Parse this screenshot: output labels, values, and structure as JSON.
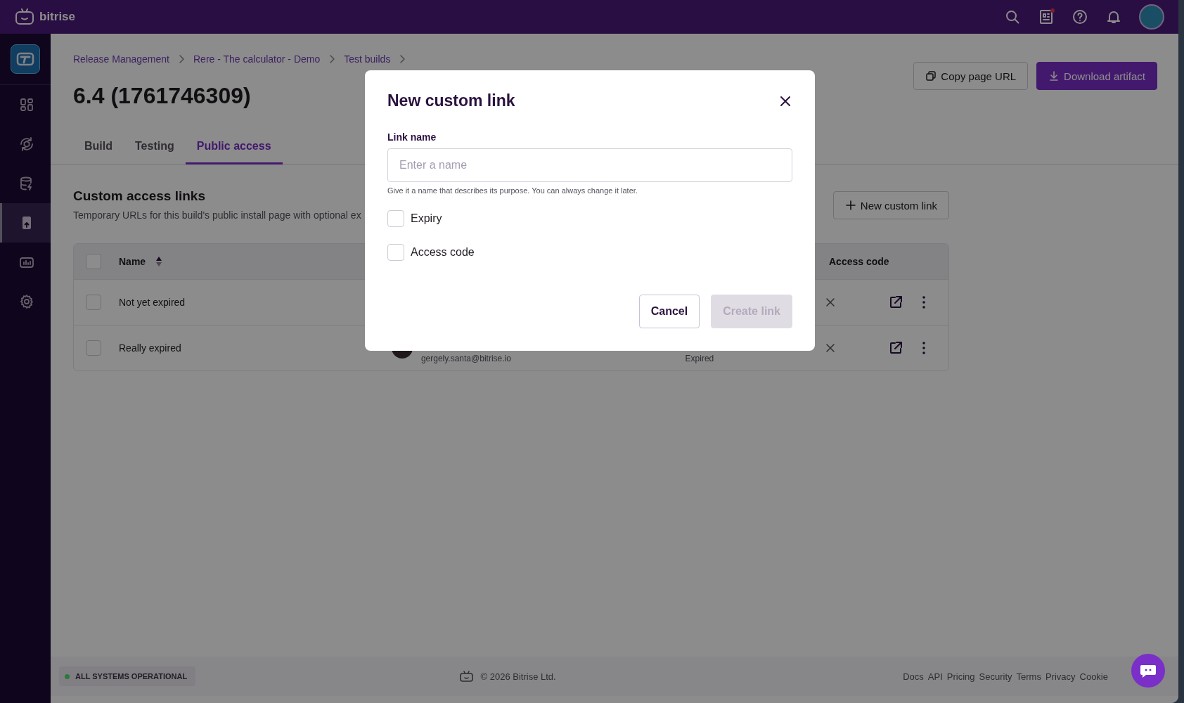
{
  "topbar": {
    "logo_text": "bitrise",
    "icons": [
      {
        "kind": "search"
      },
      {
        "kind": "news",
        "badge": true
      },
      {
        "kind": "help"
      },
      {
        "kind": "bell"
      },
      {
        "kind": "avatar"
      }
    ]
  },
  "sidebar": {
    "items": [
      {
        "kind": "grid",
        "selected": false
      },
      {
        "kind": "cycle",
        "selected": false
      },
      {
        "kind": "database",
        "selected": false
      },
      {
        "kind": "phone",
        "selected": true
      },
      {
        "kind": "chart",
        "selected": false
      },
      {
        "kind": "gear",
        "selected": false
      }
    ]
  },
  "breadcrumbs": [
    "Release Management",
    "Rere - The calculator - Demo",
    "Test builds"
  ],
  "page_title": "6.4 (1761746309)",
  "header_buttons": [
    {
      "label": "Copy page URL",
      "kind": "secondary"
    },
    {
      "label": "Download artifact",
      "kind": "primary"
    }
  ],
  "tabs": [
    {
      "label": "Build",
      "selected": false
    },
    {
      "label": "Testing",
      "selected": false
    },
    {
      "label": "Public access",
      "selected": true
    }
  ],
  "section": {
    "title": "Custom access links",
    "description": "Temporary URLs for this build's public install page with optional ex",
    "new_button": "New custom link"
  },
  "table": {
    "all_selected": false,
    "columns": [
      {
        "label": "Name",
        "sortable": true
      },
      {
        "label": "Access code",
        "sortable": false
      }
    ],
    "rows": [
      {
        "name": "Not yet expired",
        "selected": false,
        "access_code": false
      },
      {
        "name": "Really expired",
        "selected": false,
        "creator_email": "gergely.santa@bitrise.io",
        "status": "Expired",
        "access_code": false
      }
    ]
  },
  "modal": {
    "title": "New custom link",
    "field": {
      "label": "Link name",
      "placeholder": "Enter a name",
      "hint": "Give it a name that describes its purpose. You can always change it later."
    },
    "options": [
      {
        "label": "Expiry",
        "checked": false
      },
      {
        "label": "Access code",
        "checked": false
      }
    ],
    "buttons": [
      {
        "label": "Cancel",
        "kind": "secondary",
        "disabled": false
      },
      {
        "label": "Create link",
        "kind": "primary",
        "disabled": true
      }
    ]
  },
  "footer": {
    "status": {
      "label": "ALL SYSTEMS OPERATIONAL",
      "color": "#2b7a3a"
    },
    "copyright": "© 2026 Bitrise Ltd.",
    "links": [
      "Docs",
      "API",
      "Pricing",
      "Security",
      "Terms",
      "Privacy",
      "Cookie"
    ]
  }
}
